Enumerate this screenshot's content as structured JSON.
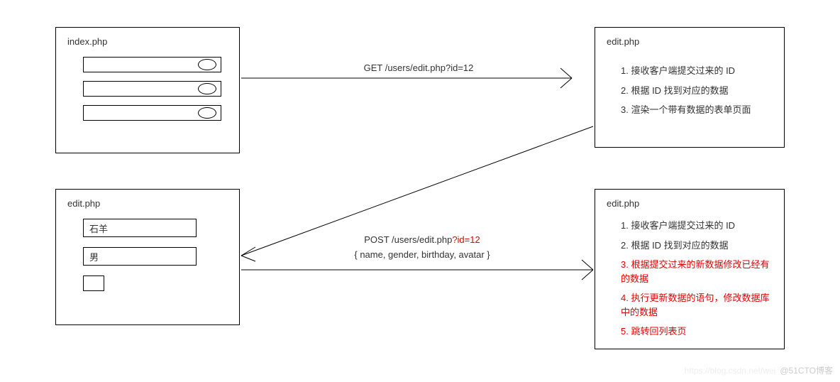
{
  "boxes": {
    "index": {
      "title": "index.php"
    },
    "editTop": {
      "title": "edit.php",
      "steps": [
        {
          "text": "1. 接收客户端提交过来的 ID",
          "red": false
        },
        {
          "text": "2. 根据 ID 找到对应的数据",
          "red": false
        },
        {
          "text": "3. 渲染一个带有数据的表单页面",
          "red": false
        }
      ]
    },
    "editForm": {
      "title": "edit.php",
      "fields": {
        "name": "石羊",
        "gender": "男"
      }
    },
    "editBottom": {
      "title": "edit.php",
      "steps": [
        {
          "text": "1. 接收客户端提交过来的 ID",
          "red": false
        },
        {
          "text": "2. 根据 ID 找到对应的数据",
          "red": false
        },
        {
          "text": "3. 根据提交过来的新数据修改已经有的数据",
          "red": true
        },
        {
          "text": "4. 执行更新数据的语句，修改数据库中的数据",
          "red": true
        },
        {
          "text": "5. 跳转回列表页",
          "red": true
        }
      ]
    }
  },
  "arrows": {
    "get": {
      "label": "GET /users/edit.php?id=12",
      "queryPart": "?id=12"
    },
    "post": {
      "label_prefix": "POST /users/edit.php",
      "label_suffix": "?id=12",
      "body": "{ name, gender, birthday, avatar }"
    }
  },
  "watermark": {
    "faded": "https://blog.csdn.net/wei",
    "text": "@51CTO博客"
  },
  "chart_data": {
    "type": "table",
    "description": "PHP edit flow diagram showing GET to load form and POST to save data",
    "nodes": [
      {
        "id": "index",
        "label": "index.php",
        "kind": "list-view"
      },
      {
        "id": "edit-get",
        "label": "edit.php",
        "kind": "handler",
        "steps": [
          "接收客户端提交过来的 ID",
          "根据 ID 找到对应的数据",
          "渲染一个带有数据的表单页面"
        ]
      },
      {
        "id": "edit-form",
        "label": "edit.php",
        "kind": "form-view",
        "fields": {
          "name": "石羊",
          "gender": "男"
        }
      },
      {
        "id": "edit-post",
        "label": "edit.php",
        "kind": "handler",
        "steps": [
          "接收客户端提交过来的 ID",
          "根据 ID 找到对应的数据",
          "根据提交过来的新数据修改已经有的数据",
          "执行更新数据的语句，修改数据库中的数据",
          "跳转回列表页"
        ]
      }
    ],
    "edges": [
      {
        "from": "index",
        "to": "edit-get",
        "method": "GET",
        "url": "/users/edit.php?id=12"
      },
      {
        "from": "edit-get",
        "to": "edit-form",
        "kind": "render"
      },
      {
        "from": "edit-form",
        "to": "edit-post",
        "method": "POST",
        "url": "/users/edit.php?id=12",
        "body": "{ name, gender, birthday, avatar }"
      }
    ]
  }
}
